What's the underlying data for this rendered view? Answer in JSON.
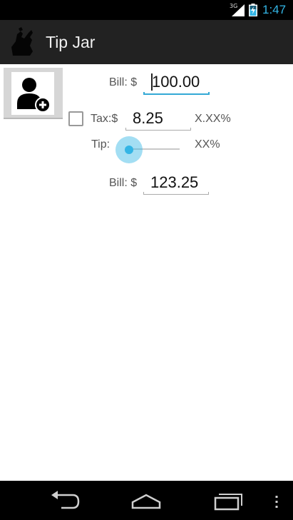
{
  "status_bar": {
    "network": "3G",
    "time": "1:47",
    "accent_color": "#33b5e5"
  },
  "action_bar": {
    "title": "Tip Jar",
    "icon": "tip-jar-app-icon",
    "background": "#222222"
  },
  "form": {
    "contact_icon": "add-contact-icon",
    "bill_label": "Bill: $",
    "bill_value": "100.00",
    "tax_checkbox_checked": false,
    "tax_label": "Tax:$",
    "tax_value": "8.25",
    "tax_percent": "X.XX%",
    "tip_label": "Tip:",
    "tip_percent": "XX%",
    "tip_slider_fraction": 0.0,
    "total_label": "Bill: $",
    "total_value": "123.25"
  },
  "nav_bar": {
    "buttons": [
      "back-icon",
      "home-icon",
      "recent-apps-icon",
      "overflow-menu-icon"
    ]
  }
}
